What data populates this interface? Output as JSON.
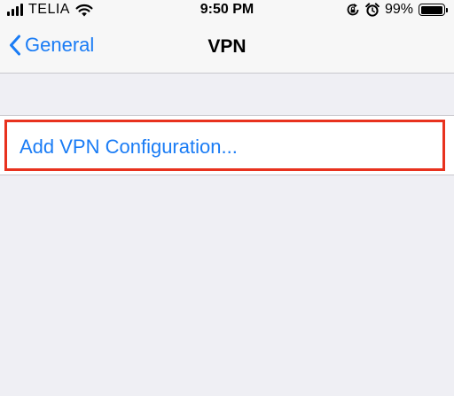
{
  "status_bar": {
    "carrier": "TELIA",
    "time": "9:50 PM",
    "battery_percent": "99%",
    "battery_level": 0.99,
    "icons": [
      "signal-bars-icon",
      "wifi-icon",
      "rotation-lock-icon",
      "alarm-icon",
      "battery-icon"
    ]
  },
  "nav_bar": {
    "back_label": "General",
    "title": "VPN"
  },
  "content": {
    "add_vpn_label": "Add VPN Configuration..."
  },
  "colors": {
    "accent": "#1a7cf5",
    "highlight_border": "#e8321e",
    "background": "#efeff4"
  }
}
